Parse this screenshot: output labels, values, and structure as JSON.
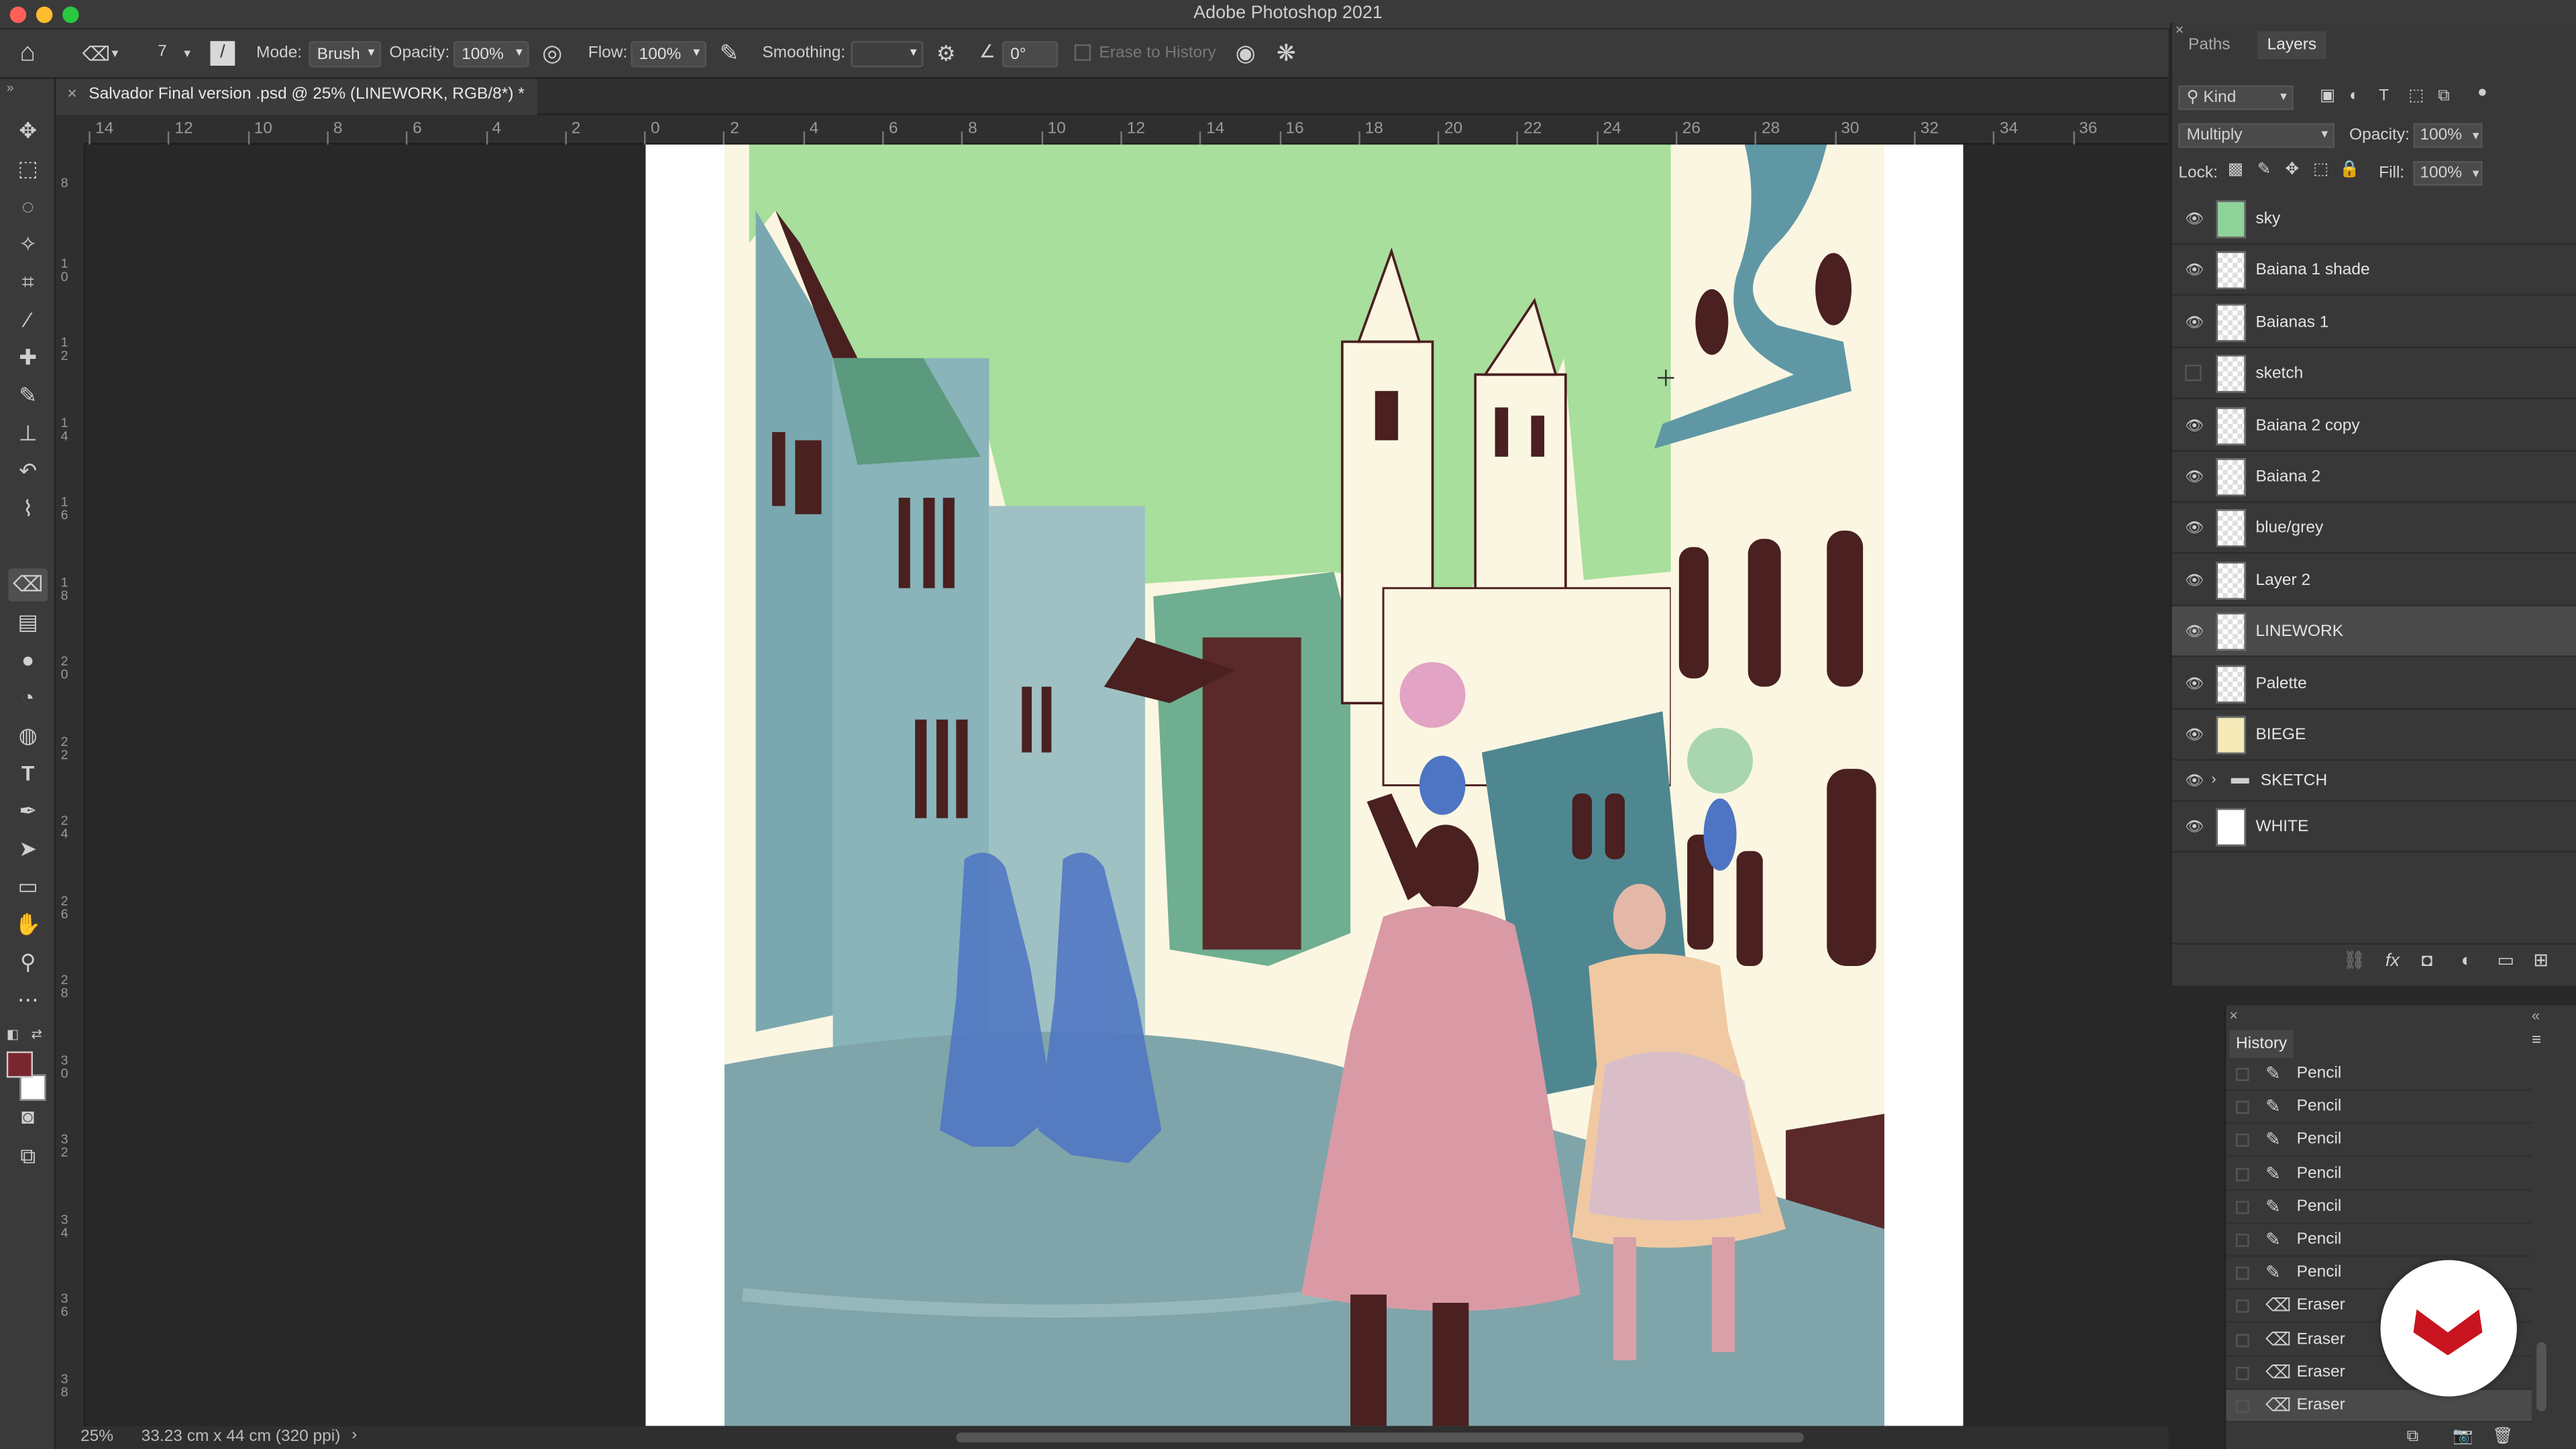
{
  "app": {
    "title": "Adobe Photoshop 2021"
  },
  "options": {
    "mode_label": "Mode:",
    "mode_value": "Brush",
    "opacity_label": "Opacity:",
    "opacity_value": "100%",
    "flow_label": "Flow:",
    "flow_value": "100%",
    "smoothing_label": "Smoothing:",
    "angle_value": "0°",
    "erase_history_label": "Erase to History",
    "brush_size": "7"
  },
  "document": {
    "tab_title": "Salvador Final version .psd @ 25% (LINEWORK, RGB/8*) *",
    "close_glyph": "×"
  },
  "rulers": {
    "h_labels": [
      "14",
      "12",
      "10",
      "8",
      "6",
      "4",
      "2",
      "0",
      "2",
      "4",
      "6",
      "8",
      "10",
      "12",
      "14",
      "16",
      "18",
      "20",
      "22",
      "24",
      "26",
      "28",
      "30",
      "32",
      "34",
      "36"
    ],
    "v_labels": [
      "8",
      "1 0",
      "1 2",
      "1 4",
      "1 6",
      "1 8",
      "2 0",
      "2 2",
      "2 4",
      "2 6",
      "2 8",
      "3 0",
      "3 2",
      "3 4",
      "3 6",
      "3 8"
    ]
  },
  "status": {
    "zoom": "25%",
    "doc_size": "33.23 cm x 44 cm (320 ppi)",
    "arrow": "›"
  },
  "layers_panel": {
    "tabs": [
      "Paths",
      "Layers"
    ],
    "filter_kind": "Kind",
    "blend_mode": "Multiply",
    "opacity_label": "Opacity:",
    "opacity_value": "100%",
    "lock_label": "Lock:",
    "fill_label": "Fill:",
    "fill_value": "100%",
    "layers": [
      {
        "name": "sky",
        "visible": true,
        "thumb": "#8fd39a"
      },
      {
        "name": "Baiana 1 shade",
        "visible": true,
        "thumb": "checker"
      },
      {
        "name": "Baianas 1",
        "visible": true,
        "thumb": "checker"
      },
      {
        "name": "sketch",
        "visible": false,
        "thumb": "checker"
      },
      {
        "name": "Baiana 2 copy",
        "visible": true,
        "thumb": "checker"
      },
      {
        "name": "Baiana 2",
        "visible": true,
        "thumb": "checker"
      },
      {
        "name": "blue/grey",
        "visible": true,
        "thumb": "checker"
      },
      {
        "name": "Layer 2",
        "visible": true,
        "thumb": "checker"
      },
      {
        "name": "LINEWORK",
        "visible": true,
        "thumb": "checker",
        "selected": true
      },
      {
        "name": "Palette",
        "visible": true,
        "thumb": "checker"
      },
      {
        "name": "BIEGE",
        "visible": true,
        "thumb": "#f4eab8"
      },
      {
        "name": "SKETCH",
        "visible": true,
        "thumb": "folder",
        "group": true
      },
      {
        "name": "WHITE",
        "visible": true,
        "thumb": "#ffffff"
      }
    ]
  },
  "history_panel": {
    "title": "History",
    "items": [
      "Pencil",
      "Pencil",
      "Pencil",
      "Pencil",
      "Pencil",
      "Pencil",
      "Pencil",
      "Eraser",
      "Eraser",
      "Eraser",
      "Eraser"
    ],
    "selected_index": 10
  },
  "colors": {
    "foreground": "#7a2630",
    "background": "#ffffff",
    "sky": "#a8df9c",
    "beige": "#fbf6e2",
    "teal": "#6f9fa8",
    "street": "#7fa5aa",
    "pink": "#d99aa6",
    "sketch_blue": "#4e74c4",
    "brown": "#4a2020",
    "logo_red": "#c8141e"
  }
}
